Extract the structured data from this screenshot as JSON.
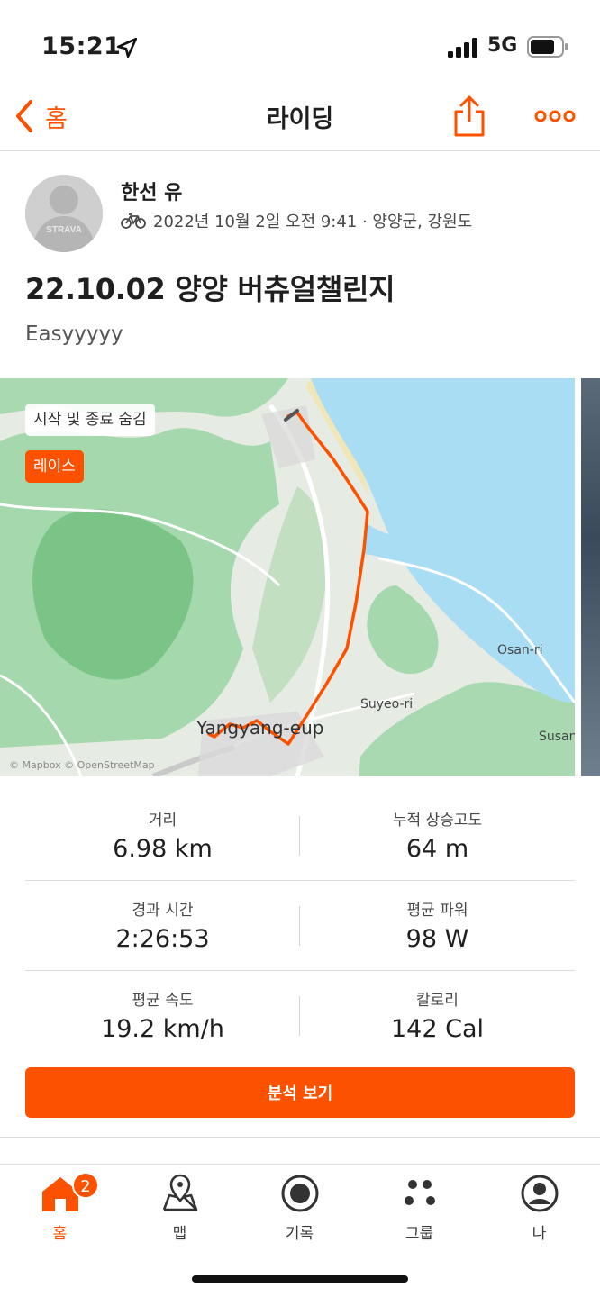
{
  "status_bar": {
    "time": "15:21",
    "network": "5G"
  },
  "nav": {
    "back_label": "홈",
    "title": "라이딩"
  },
  "activity": {
    "athlete_name": "한선 유",
    "meta": "2022년 10월 2일 오전 9:41 · 양양군, 강원도",
    "title": "22.10.02 양양 버츄얼챌린지",
    "description": "Easyyyyy",
    "avatar_brand": "STRAVA"
  },
  "map": {
    "hide_start_end_label": "시작 및 종료 숨김",
    "race_badge": "레이스",
    "places": {
      "osan": "Osan-ri",
      "suyeo": "Suyeo-ri",
      "susan": "Susan",
      "town": "Yangyang-eup"
    },
    "attribution": "© Mapbox © OpenStreetMap"
  },
  "stats": [
    {
      "label": "거리",
      "value": "6.98 km"
    },
    {
      "label": "누적 상승고도",
      "value": "64 m"
    },
    {
      "label": "경과 시간",
      "value": "2:26:53"
    },
    {
      "label": "평균 파워",
      "value": "98 W"
    },
    {
      "label": "평균 속도",
      "value": "19.2 km/h"
    },
    {
      "label": "칼로리",
      "value": "142 Cal"
    }
  ],
  "analyze_button": "분석 보기",
  "tabs": [
    {
      "label": "홈",
      "icon": "home-icon",
      "active": true,
      "badge": "2"
    },
    {
      "label": "맵",
      "icon": "map-icon"
    },
    {
      "label": "기록",
      "icon": "record-icon"
    },
    {
      "label": "그룹",
      "icon": "groups-icon"
    },
    {
      "label": "나",
      "icon": "profile-icon"
    }
  ],
  "colors": {
    "accent": "#fc5200",
    "route": "#fc5200",
    "water": "#a9ddf3",
    "land": "#e6ebe4",
    "forest": "#8fd19b"
  }
}
